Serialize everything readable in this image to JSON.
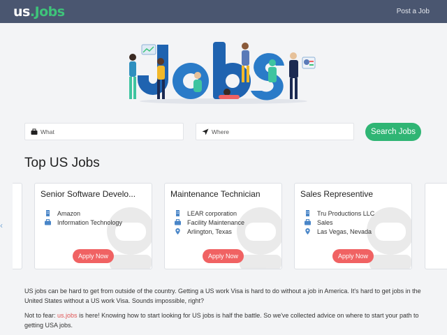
{
  "header": {
    "logo_us": "us",
    "logo_dot": ".",
    "logo_jobs": "Jobs",
    "post_job": "Post a Job"
  },
  "search": {
    "what_placeholder": "What",
    "where_placeholder": "Where",
    "button": "Search Jobs"
  },
  "section_title": "Top US Jobs",
  "cards": [
    {
      "title": "Senior Software Develo...",
      "company": "Amazon",
      "category": "Information Technology",
      "location": "",
      "apply": "Apply Now"
    },
    {
      "title": "Maintenance Technician",
      "company": "LEAR corporation",
      "category": "Facility Maintenance",
      "location": "Arlington, Texas",
      "apply": "Apply Now"
    },
    {
      "title": "Sales Representive",
      "company": "Tru Productions LLC",
      "category": "Sales",
      "location": "Las Vegas, Nevada",
      "apply": "Apply Now"
    }
  ],
  "carousel": {
    "prev": "‹",
    "next": "›"
  },
  "paragraphs": {
    "p1": "US jobs can be hard to get from outside of the country. Getting a US work Visa is hard to do without a job in America. It's hard to get jobs in the United States without a US work Visa. Sounds impossible, right?",
    "p2_before": "Not to fear: ",
    "p2_link": "us.jobs",
    "p2_after": " is here! Knowing how to start looking for US jobs is half the battle. So we've collected advice on where to start your path to getting USA jobs."
  },
  "colors": {
    "header": "#4a5670",
    "brand_green": "#3ec47a",
    "search_button": "#2fb574",
    "apply_button": "#f06263",
    "link": "#e05555"
  }
}
